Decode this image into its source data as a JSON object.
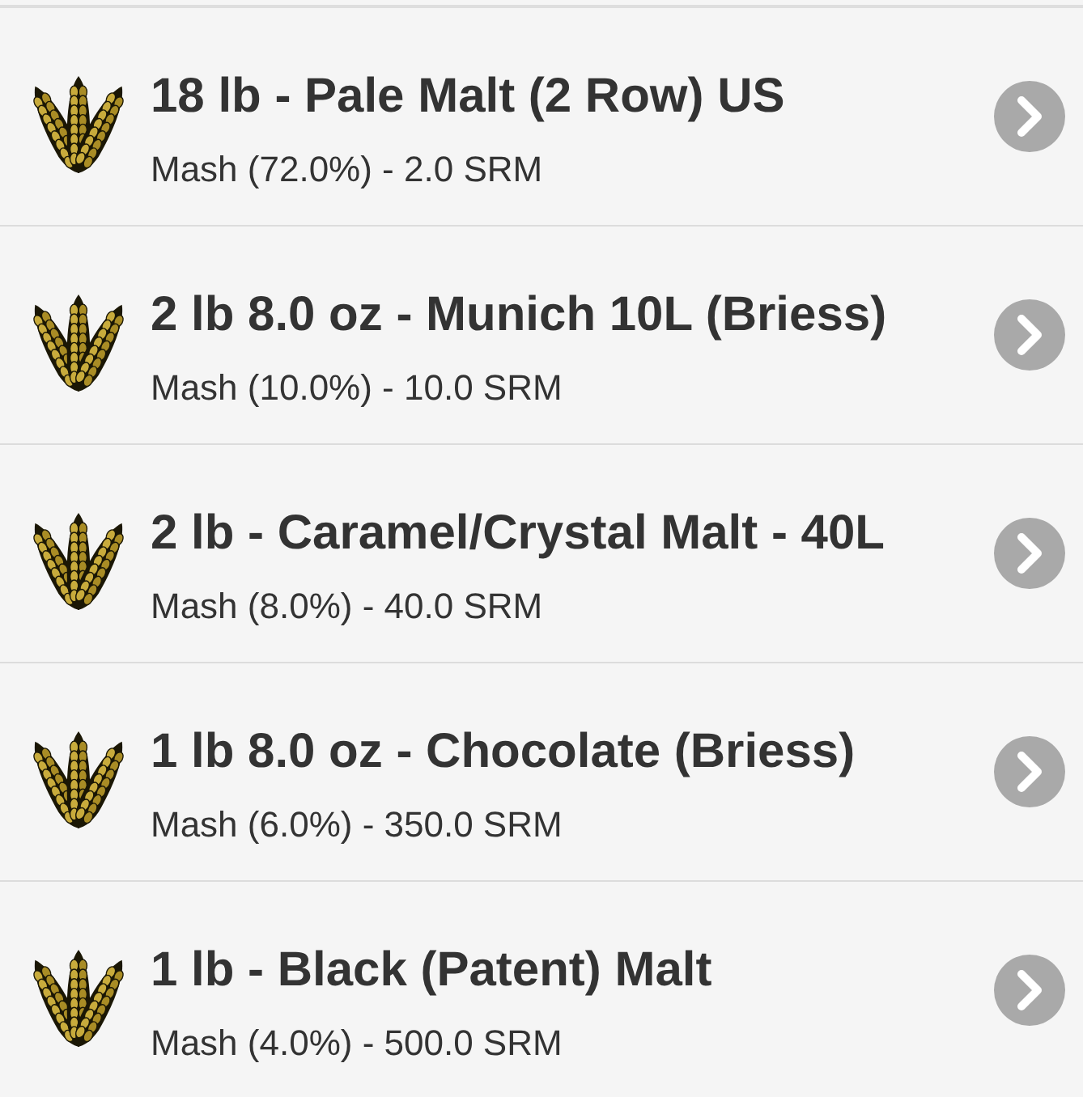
{
  "ingredients": [
    {
      "title": "18 lb - Pale Malt (2 Row) US",
      "detail": "Mash (72.0%) - 2.0 SRM"
    },
    {
      "title": "2 lb 8.0 oz - Munich 10L (Briess)",
      "detail": "Mash (10.0%) - 10.0 SRM"
    },
    {
      "title": "2 lb - Caramel/Crystal Malt - 40L",
      "detail": "Mash (8.0%) - 40.0 SRM"
    },
    {
      "title": "1 lb 8.0 oz - Chocolate (Briess)",
      "detail": "Mash (6.0%) - 350.0 SRM"
    },
    {
      "title": "1 lb - Black (Patent) Malt",
      "detail": "Mash (4.0%) - 500.0 SRM"
    }
  ]
}
